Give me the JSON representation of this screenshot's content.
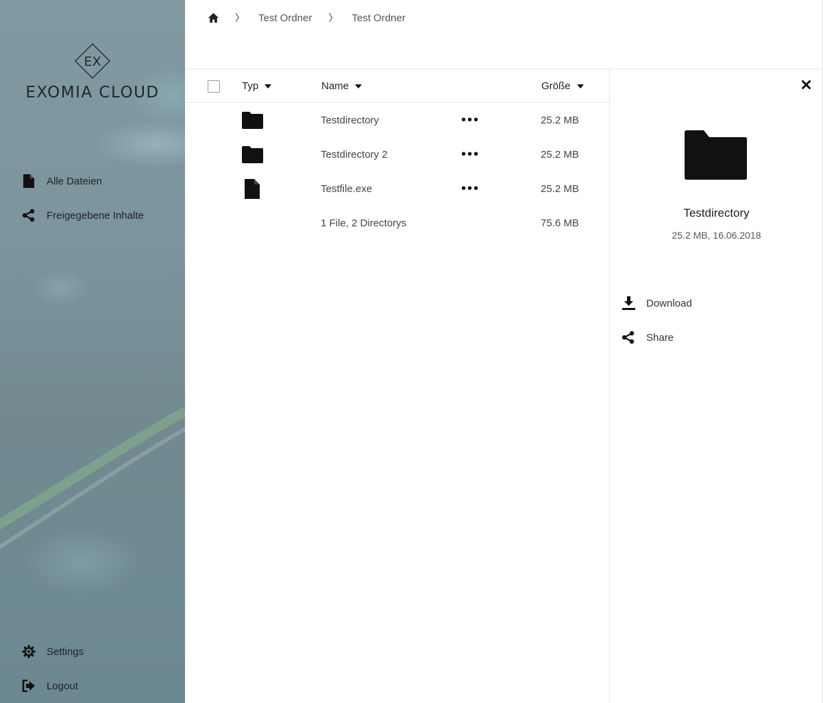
{
  "app": {
    "logo_mark": "EX",
    "name": "EXOMIA CLOUD"
  },
  "sidebar": {
    "items": [
      {
        "label": "Alle Dateien",
        "icon": "file-icon"
      },
      {
        "label": "Freigegebene Inhalte",
        "icon": "share-icon"
      }
    ],
    "bottom": [
      {
        "label": "Settings",
        "icon": "gear-icon"
      },
      {
        "label": "Logout",
        "icon": "logout-icon"
      }
    ]
  },
  "breadcrumb": {
    "items": [
      "Test Ordner",
      "Test Ordner"
    ]
  },
  "table": {
    "columns": {
      "type": "Typ",
      "name": "Name",
      "size": "Größe"
    },
    "rows": [
      {
        "type": "folder",
        "name": "Testdirectory",
        "size": "25.2 MB"
      },
      {
        "type": "folder",
        "name": "Testdirectory 2",
        "size": "25.2 MB"
      },
      {
        "type": "file",
        "name": "Testfile.exe",
        "size": "25.2 MB"
      }
    ],
    "summary": {
      "text": "1 File, 2 Directorys",
      "size": "75.6 MB"
    }
  },
  "detail": {
    "title": "Testdirectory",
    "meta": "25.2 MB, 16.06.2018",
    "actions": {
      "download": "Download",
      "share": "Share"
    }
  }
}
